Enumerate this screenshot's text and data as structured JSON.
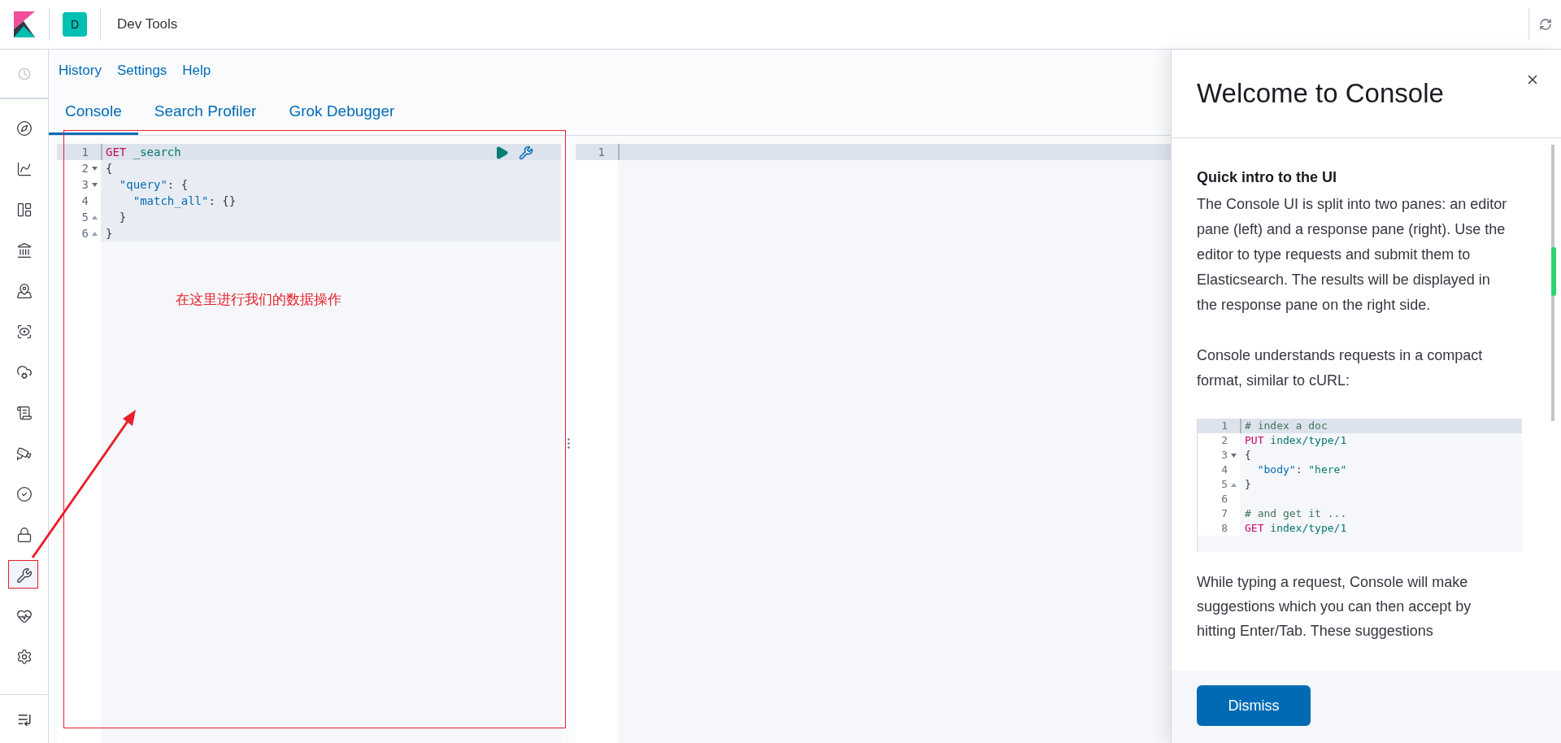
{
  "header": {
    "space_avatar": "D",
    "title": "Dev Tools"
  },
  "sidebar": {
    "items": [
      {
        "selected": false
      },
      {
        "selected": false
      },
      {
        "selected": false
      },
      {
        "selected": false
      },
      {
        "selected": false
      },
      {
        "selected": false
      },
      {
        "selected": false
      },
      {
        "selected": false
      },
      {
        "selected": false
      },
      {
        "selected": false
      },
      {
        "selected": false
      },
      {
        "selected": true
      },
      {
        "selected": false
      },
      {
        "selected": false
      }
    ]
  },
  "top_links": [
    "History",
    "Settings",
    "Help"
  ],
  "tabs": [
    {
      "label": "Console",
      "selected": true
    },
    {
      "label": "Search Profiler",
      "selected": false
    },
    {
      "label": "Grok Debugger",
      "selected": false
    }
  ],
  "editor": {
    "lines": [
      {
        "number": "1",
        "active": true,
        "fold_start": false,
        "fold_end": false,
        "tokens": [
          {
            "kind": "method",
            "text": "GET"
          },
          {
            "kind": "url",
            "text": " _search"
          }
        ]
      },
      {
        "number": "2",
        "active": false,
        "fold_start": true,
        "fold_end": false,
        "tokens": [
          {
            "kind": "plain",
            "text": "{"
          }
        ]
      },
      {
        "number": "3",
        "active": false,
        "fold_start": true,
        "fold_end": false,
        "tokens": [
          {
            "kind": "key",
            "text": "  \"query\""
          },
          {
            "kind": "plain",
            "text": ": {"
          }
        ]
      },
      {
        "number": "4",
        "active": false,
        "fold_start": false,
        "fold_end": false,
        "tokens": [
          {
            "kind": "key",
            "text": "    \"match_all\""
          },
          {
            "kind": "plain",
            "text": ": {}"
          }
        ]
      },
      {
        "number": "5",
        "active": false,
        "fold_start": false,
        "fold_end": true,
        "tokens": [
          {
            "kind": "plain",
            "text": "  }"
          }
        ]
      },
      {
        "number": "6",
        "active": false,
        "fold_start": false,
        "fold_end": true,
        "tokens": [
          {
            "kind": "plain",
            "text": "}"
          }
        ]
      }
    ]
  },
  "output": {
    "lines": [
      {
        "number": "1",
        "active": true
      }
    ]
  },
  "annotation": {
    "text": "在这里进行我们的数据操作"
  },
  "flyout": {
    "title": "Welcome to Console",
    "heading": "Quick intro to the UI",
    "paragraphs": [
      "The Console UI is split into two panes: an editor pane (left) and a response pane (right). Use the editor to type requests and submit them to Elasticsearch. The results will be displayed in the response pane on the right side.",
      "Console understands requests in a compact format, similar to cURL:"
    ],
    "example": [
      {
        "number": "1",
        "active": true,
        "fold_start": false,
        "fold_end": false,
        "tokens": [
          {
            "kind": "comment",
            "text": "# index a doc"
          }
        ]
      },
      {
        "number": "2",
        "active": false,
        "fold_start": false,
        "fold_end": false,
        "tokens": [
          {
            "kind": "method",
            "text": "PUT"
          },
          {
            "kind": "url",
            "text": " index/type/1"
          }
        ]
      },
      {
        "number": "3",
        "active": false,
        "fold_start": true,
        "fold_end": false,
        "tokens": [
          {
            "kind": "plain",
            "text": "{"
          }
        ]
      },
      {
        "number": "4",
        "active": false,
        "fold_start": false,
        "fold_end": false,
        "tokens": [
          {
            "kind": "key",
            "text": "  \"body\""
          },
          {
            "kind": "plain",
            "text": ": "
          },
          {
            "kind": "string",
            "text": "\"here\""
          }
        ]
      },
      {
        "number": "5",
        "active": false,
        "fold_start": false,
        "fold_end": true,
        "tokens": [
          {
            "kind": "plain",
            "text": "}"
          }
        ]
      },
      {
        "number": "6",
        "active": false,
        "fold_start": false,
        "fold_end": false
      },
      {
        "number": "7",
        "active": false,
        "fold_start": false,
        "fold_end": false,
        "tokens": [
          {
            "kind": "comment",
            "text": "# and get it ..."
          }
        ]
      },
      {
        "number": "8",
        "active": false,
        "fold_start": false,
        "fold_end": false,
        "tokens": [
          {
            "kind": "method",
            "text": "GET"
          },
          {
            "kind": "url",
            "text": " index/type/1"
          }
        ]
      }
    ],
    "after": "While typing a request, Console will make suggestions which you can then accept by hitting Enter/Tab. These suggestions",
    "button": "Dismiss"
  }
}
